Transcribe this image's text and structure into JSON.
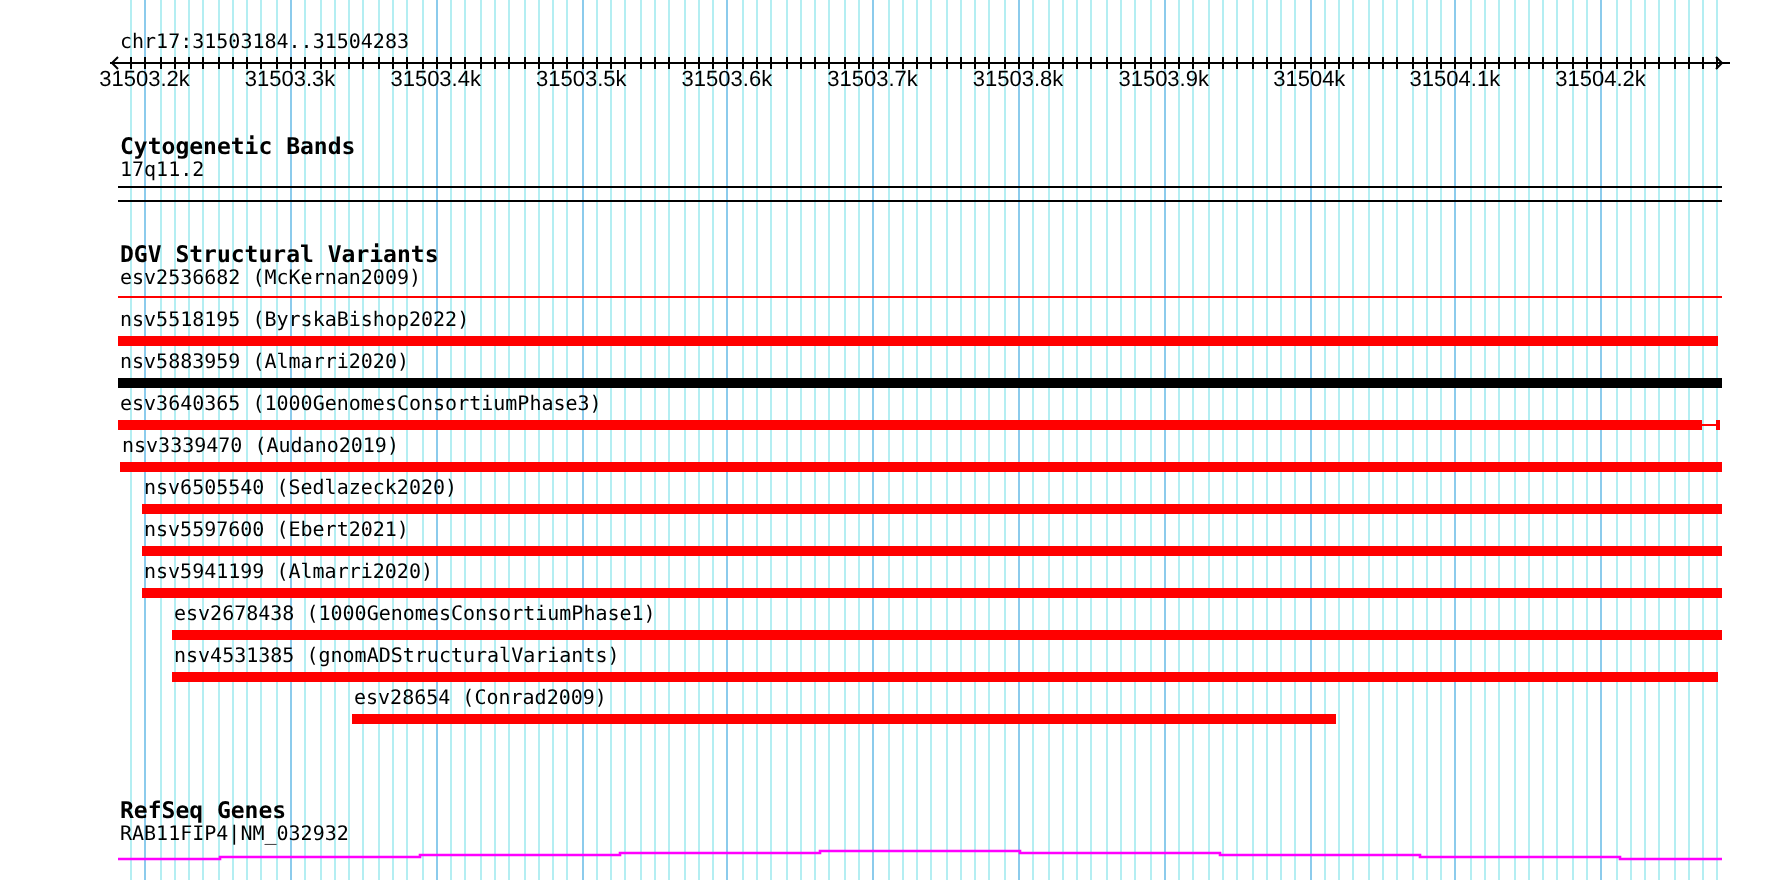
{
  "location": "chr17:31503184..31504283",
  "ruler": {
    "ticks": [
      "31503.2k",
      "31503.3k",
      "31503.4k",
      "31503.5k",
      "31503.6k",
      "31503.7k",
      "31503.8k",
      "31503.9k",
      "31504k",
      "31504.1k",
      "31504.2k"
    ]
  },
  "tracks": [
    {
      "title": "Cytogenetic Bands",
      "kind": "bands",
      "features": [
        {
          "label": "17q11.2"
        }
      ]
    },
    {
      "title": "DGV Structural Variants",
      "kind": "variants",
      "features": [
        {
          "label": "esv2536682 (McKernan2009)",
          "kind": "line",
          "color": "#ff0000"
        },
        {
          "label": "nsv5518195 (ByrskaBishop2022)",
          "kind": "bar",
          "color": "#ff0000"
        },
        {
          "label": "nsv5883959 (Almarri2020)",
          "kind": "bar",
          "color": "#000000"
        },
        {
          "label": "esv3640365 (1000GenomesConsortiumPhase3)",
          "kind": "tail",
          "color": "#ff0000"
        },
        {
          "label": "nsv3339470 (Audano2019)",
          "kind": "bar",
          "color": "#ff0000"
        },
        {
          "label": "nsv6505540 (Sedlazeck2020)",
          "kind": "bar",
          "color": "#ff0000"
        },
        {
          "label": "nsv5597600 (Ebert2021)",
          "kind": "bar",
          "color": "#ff0000"
        },
        {
          "label": "nsv5941199 (Almarri2020)",
          "kind": "bar",
          "color": "#ff0000"
        },
        {
          "label": "esv2678438 (1000GenomesConsortiumPhase1)",
          "kind": "bar",
          "color": "#ff0000"
        },
        {
          "label": "nsv4531385 (gnomADStructuralVariants)",
          "kind": "bar",
          "color": "#ff0000"
        },
        {
          "label": "esv28654 (Conrad2009)",
          "kind": "bar",
          "color": "#ff0000"
        }
      ]
    },
    {
      "title": "RefSeq Genes",
      "kind": "genes",
      "features": [
        {
          "label": "RAB11FIP4|NM_032932"
        }
      ]
    }
  ]
}
